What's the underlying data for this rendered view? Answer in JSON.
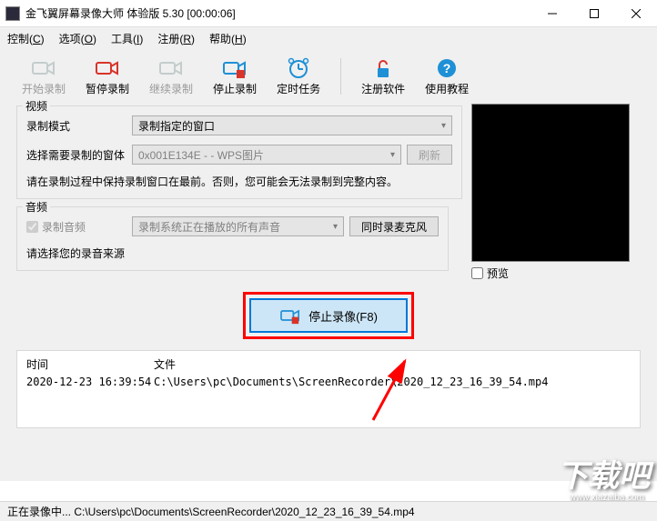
{
  "titlebar": {
    "text": "金飞翼屏幕录像大师 体验版 5.30 [00:00:06]"
  },
  "menu": {
    "control": "控制(C)",
    "options": "选项(O)",
    "tools": "工具(I)",
    "register": "注册(R)",
    "help": "帮助(H)"
  },
  "toolbar": {
    "start": "开始录制",
    "pause": "暂停录制",
    "resume": "继续录制",
    "stop": "停止录制",
    "schedule": "定时任务",
    "regsoft": "注册软件",
    "tutorial": "使用教程"
  },
  "video": {
    "group": "视频",
    "mode_label": "录制模式",
    "mode_value": "录制指定的窗口",
    "window_label": "选择需要录制的窗体",
    "window_value": "0x001E134E - - WPS图片",
    "refresh": "刷新",
    "note": "请在录制过程中保持录制窗口在最前。否则，您可能会无法录制到完整内容。"
  },
  "audio": {
    "group": "音频",
    "record_audio": "录制音频",
    "source_value": "录制系统正在播放的所有声音",
    "mic_btn": "同时录麦克风",
    "select_hint": "请选择您的录音来源"
  },
  "preview": {
    "label": "预览"
  },
  "stop_btn": "停止录像(F8)",
  "table": {
    "col_time": "时间",
    "col_file": "文件",
    "rows": [
      {
        "time": "2020-12-23 16:39:54",
        "file": "C:\\Users\\pc\\Documents\\ScreenRecorder\\2020_12_23_16_39_54.mp4"
      }
    ]
  },
  "statusbar": "正在录像中... C:\\Users\\pc\\Documents\\ScreenRecorder\\2020_12_23_16_39_54.mp4",
  "watermark": {
    "main": "下载吧",
    "sub": "www.xiazaiba.com"
  }
}
